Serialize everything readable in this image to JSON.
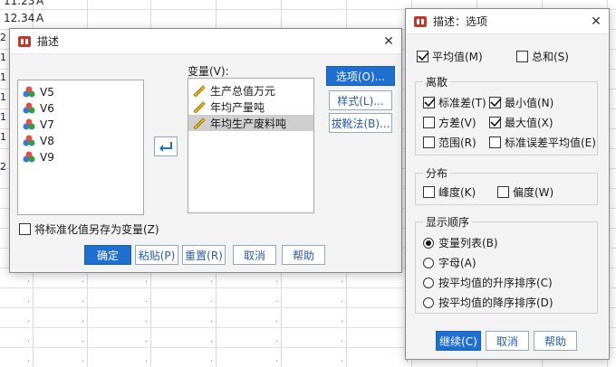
{
  "background_sheet": {
    "rows": [
      {
        "num": "",
        "a": "11.23",
        "b": "A"
      },
      {
        "num": "",
        "a": "12.34",
        "b": "A"
      },
      {
        "num": "2",
        "a": "",
        "b": ""
      },
      {
        "num": "1",
        "a": "",
        "b": ""
      },
      {
        "num": "1",
        "a": "",
        "b": ""
      },
      {
        "num": "1",
        "a": "",
        "b": ""
      },
      {
        "num": "1",
        "a": "",
        "b": ""
      },
      {
        "num": "1",
        "a": "",
        "b": ""
      },
      {
        "num": "2",
        "a": "",
        "b": ""
      }
    ]
  },
  "describe_dialog": {
    "title": "描述",
    "source_vars": [
      "V5",
      "V6",
      "V7",
      "V8",
      "V9"
    ],
    "variables_label": "变量(V):",
    "target_vars": [
      "生产总值万元",
      "年均产量吨",
      "年均生产废料吨"
    ],
    "selected_target": "年均生产废料吨",
    "buttons": {
      "options": "选项(O)...",
      "style": "样式(L)...",
      "bootstrap": "拔靴法(B)...",
      "ok": "确定",
      "paste": "粘贴(P)",
      "reset": "重置(R)",
      "cancel": "取消",
      "help": "帮助"
    },
    "save_standardized": {
      "label": "将标准化值另存为变量(Z)",
      "checked": false
    }
  },
  "options_dialog": {
    "title": "描述：选项",
    "mean": {
      "label": "平均值(M)",
      "checked": true
    },
    "sum": {
      "label": "总和(S)",
      "checked": false
    },
    "dispersion": {
      "title": "离散",
      "std_dev": {
        "label": "标准差(T)",
        "checked": true
      },
      "minimum": {
        "label": "最小值(N)",
        "checked": true
      },
      "variance": {
        "label": "方差(V)",
        "checked": false
      },
      "maximum": {
        "label": "最大值(X)",
        "checked": true
      },
      "range": {
        "label": "范围(R)",
        "checked": false
      },
      "se_mean": {
        "label": "标准误差平均值(E)",
        "checked": false
      }
    },
    "distribution": {
      "title": "分布",
      "kurtosis": {
        "label": "峰度(K)",
        "checked": false
      },
      "skewness": {
        "label": "偏度(W)",
        "checked": false
      }
    },
    "display_order": {
      "title": "显示顺序",
      "options": [
        "变量列表(B)",
        "字母(A)",
        "按平均值的升序排序(C)",
        "按平均值的降序排序(D)"
      ],
      "selected": "变量列表(B)"
    },
    "buttons": {
      "continue": "继续(C)",
      "cancel": "取消",
      "help": "帮助"
    }
  },
  "colors": {
    "accent": "#1f6fd1",
    "link_text": "#2a5aa8"
  },
  "icons": [
    "app-icon",
    "close-icon",
    "nominal-variable-icon",
    "scale-variable-icon",
    "move-arrow-icon",
    "checkmark-icon"
  ]
}
